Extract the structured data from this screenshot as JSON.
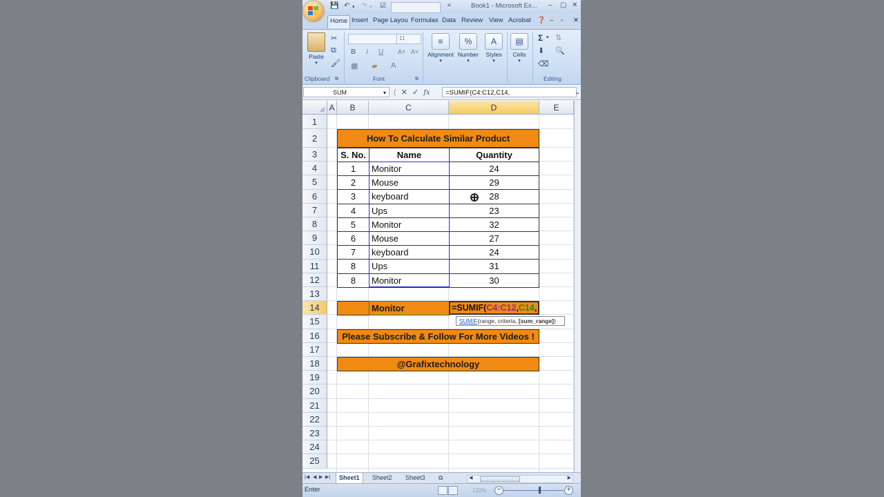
{
  "window": {
    "title": "Book1 - Microsoft Ex...",
    "controls": [
      "–",
      "▢",
      "✕"
    ]
  },
  "tabs": [
    "Home",
    "Insert",
    "Page Layou",
    "Formulas",
    "Data",
    "Review",
    "View",
    "Acrobat"
  ],
  "ribbon": {
    "paste": "Paste",
    "clipboard": "Clipboard",
    "font_size": "11",
    "font_group": "Font",
    "bold": "B",
    "italic": "I",
    "underline": "U",
    "alignment": "Alignment",
    "number": "Number",
    "styles": "Styles",
    "cells": "Cells",
    "editing": "Editing",
    "sigma": "Σ"
  },
  "formula_bar": {
    "name_box": "SUM",
    "fx": "fx",
    "formula": "=SUMIF(C4:C12,C14,"
  },
  "columns": [
    "A",
    "B",
    "C",
    "D",
    "E"
  ],
  "rows": [
    "1",
    "2",
    "3",
    "4",
    "5",
    "6",
    "7",
    "8",
    "9",
    "10",
    "11",
    "12",
    "13",
    "14",
    "15",
    "16",
    "17",
    "18",
    "19",
    "20",
    "21",
    "22",
    "23",
    "24",
    "25"
  ],
  "sheet": {
    "title": "How To Calculate Similar Product",
    "headers": {
      "sno": "S. No.",
      "name": "Name",
      "qty": "Quantity"
    },
    "table": [
      {
        "sno": "1",
        "name": "Monitor",
        "qty": "24"
      },
      {
        "sno": "2",
        "name": "Mouse",
        "qty": "29"
      },
      {
        "sno": "3",
        "name": "keyboard",
        "qty": "28"
      },
      {
        "sno": "4",
        "name": "Ups",
        "qty": "23"
      },
      {
        "sno": "5",
        "name": "Monitor",
        "qty": "32"
      },
      {
        "sno": "6",
        "name": "Mouse",
        "qty": "27"
      },
      {
        "sno": "7",
        "name": "keyboard",
        "qty": "24"
      },
      {
        "sno": "8",
        "name": "Ups",
        "qty": "31"
      },
      {
        "sno": "8",
        "name": "Monitor",
        "qty": "30"
      }
    ],
    "criteria": "Monitor",
    "formula_parts": {
      "a": "=SUMIF(",
      "b": "C4:C12",
      "c": ",",
      "d": "C14",
      "e": ","
    },
    "tooltip": {
      "fn": "SUMIF",
      "args": "(range, criteria, ",
      "opt": "[sum_range]",
      "end": ")"
    },
    "subscribe": "Please Subscribe & Follow For More Videos !",
    "handle": "@Grafixtechnology"
  },
  "sheet_tabs": [
    "Sheet1",
    "Sheet2",
    "Sheet3"
  ],
  "status": {
    "mode": "Enter",
    "zoom": "120%"
  },
  "colors": {
    "orange": "#f08a12",
    "ref_blue": "#2b2bd8",
    "ref_green": "#1f8a2a",
    "ref_purple": "#8a2ba8"
  }
}
